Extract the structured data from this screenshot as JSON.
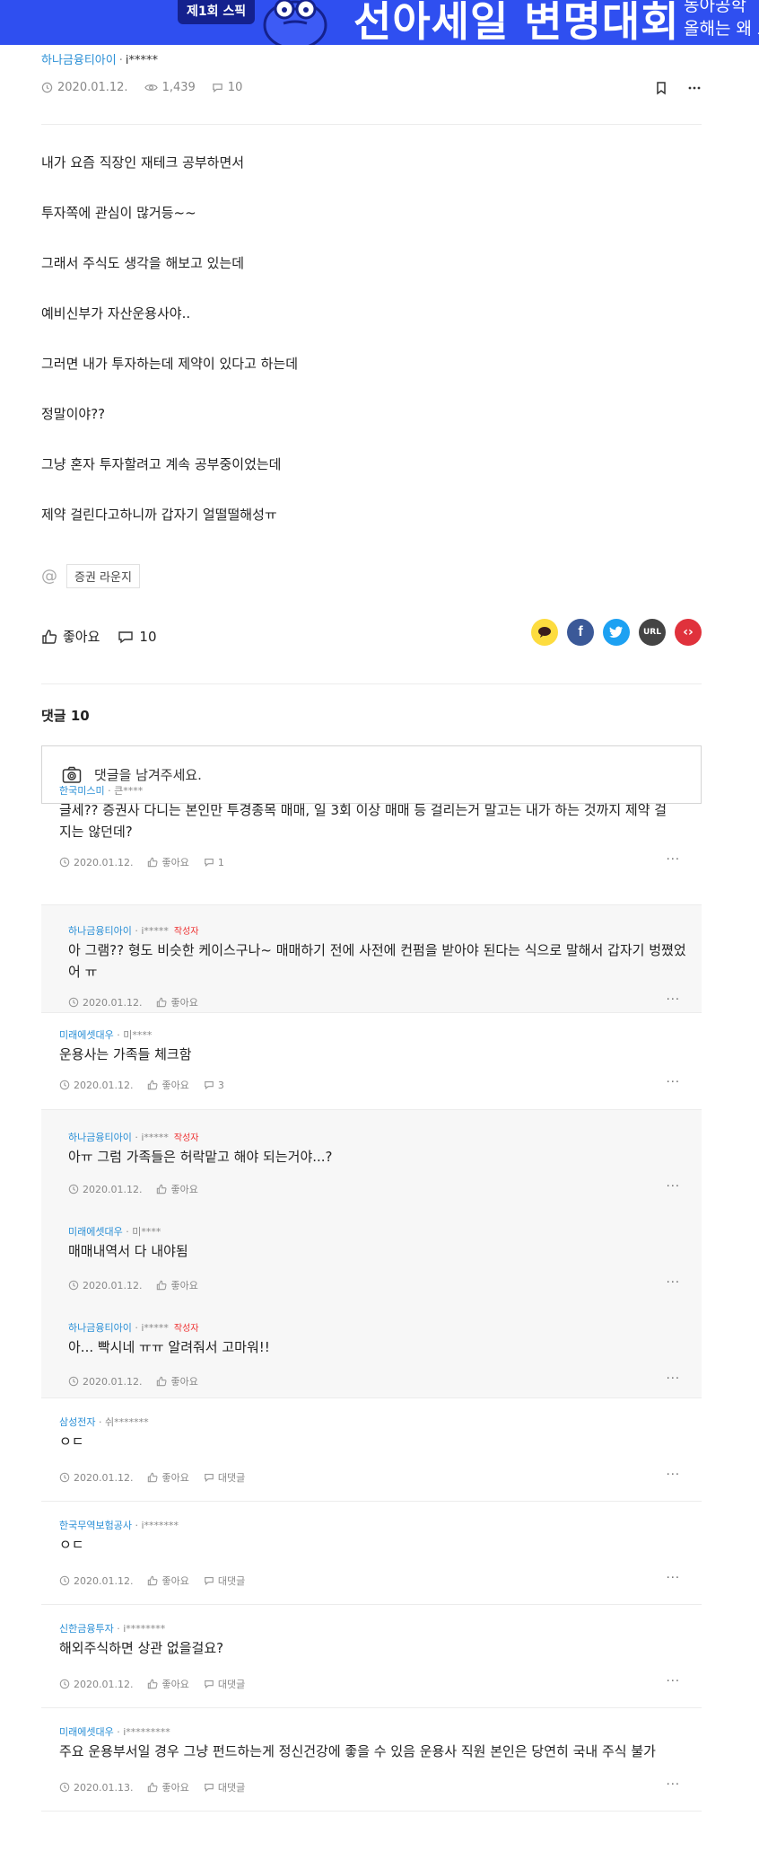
{
  "banner": {
    "badge": "제1회 스픽",
    "title": "선아세일 변명대회",
    "side_line1": "동아공학",
    "side_line2": "올해는 왜 도"
  },
  "post": {
    "company": "하나금융티아이",
    "user": "i*****",
    "date": "2020.01.12.",
    "views": "1,439",
    "comments": "10",
    "lines": [
      "내가 요즘 직장인 재테크 공부하면서",
      "투자쪽에 관심이 많거등~~",
      "그래서 주식도 생각을 해보고 있는데",
      "예비신부가 자산운용사야..",
      "그러면 내가 투자하는데 제약이 있다고 하는데",
      "정말이야??",
      "그냥 혼자 투자할려고 계속 공부중이었는데",
      "제약 걸린다고하니까 갑자기 얼떨떨해성ㅠ"
    ],
    "tag": "증권 라운지",
    "like_label": "좋아요",
    "comment_count": "10"
  },
  "share": {
    "url_label": "URL",
    "code_label": "‹›",
    "colors": {
      "kakao": "#fddc3f",
      "facebook": "#3b5998",
      "twitter": "#1da1f2",
      "url": "#444444",
      "code": "#e0323c"
    }
  },
  "comments_section": {
    "title": "댓글 10",
    "placeholder": "댓글을 남겨주세요."
  },
  "comments": [
    {
      "company": "한국미스미",
      "user": "큰****",
      "mine": "",
      "text": "글세?? 증권사 다니는 본인만 투경종목 매매, 일 3회 이상 매매 등 걸리는거 말고는 내가 하는 것까지 제약 걸지는 않던데?",
      "date": "2020.01.12.",
      "like": "좋아요",
      "extra": "1",
      "reply": false
    },
    {
      "company": "하나금융티아이",
      "user": "i*****",
      "mine": "작성자",
      "text": "아 그램?? 형도 비슷한 케이스구나~ 매매하기 전에 사전에 컨펌을 받아야 된다는 식으로 말해서 갑자기 벙쪘었어 ㅠ",
      "date": "2020.01.12.",
      "like": "좋아요",
      "extra": "",
      "reply": true
    },
    {
      "company": "미래에셋대우",
      "user": "미****",
      "mine": "",
      "text": "운용사는 가족들 체크함",
      "date": "2020.01.12.",
      "like": "좋아요",
      "extra": "3",
      "reply": false
    },
    {
      "company": "하나금융티아이",
      "user": "i*****",
      "mine": "작성자",
      "text": "아ㅠ 그럼 가족들은 허락맡고 해야 되는거야...?",
      "date": "2020.01.12.",
      "like": "좋아요",
      "extra": "",
      "reply": true
    },
    {
      "company": "미래에셋대우",
      "user": "미****",
      "mine": "",
      "text": "매매내역서 다 내야됨",
      "date": "2020.01.12.",
      "like": "좋아요",
      "extra": "",
      "reply": true
    },
    {
      "company": "하나금융티아이",
      "user": "i*****",
      "mine": "작성자",
      "text": "아... 빡시네 ㅠㅠ 알려줘서 고마워!!",
      "date": "2020.01.12.",
      "like": "좋아요",
      "extra": "",
      "reply": true
    },
    {
      "company": "삼성전자",
      "user": "쉬*******",
      "mine": "",
      "text": "ㅇㄷ",
      "date": "2020.01.12.",
      "like": "좋아요",
      "extra": "대댓글",
      "reply": false
    },
    {
      "company": "한국무역보험공사",
      "user": "i*******",
      "mine": "",
      "text": "ㅇㄷ",
      "date": "2020.01.12.",
      "like": "좋아요",
      "extra": "대댓글",
      "reply": false
    },
    {
      "company": "신한금융투자",
      "user": "i********",
      "mine": "",
      "text": "해외주식하면 상관 없을걸요?",
      "date": "2020.01.12.",
      "like": "좋아요",
      "extra": "대댓글",
      "reply": false
    },
    {
      "company": "미래에셋대우",
      "user": "i*********",
      "mine": "",
      "text": "주요 운용부서일 경우 그냥 펀드하는게 정신건강에 좋을 수 있음 운용사 직원 본인은 당연히 국내 주식 불가",
      "date": "2020.01.13.",
      "like": "좋아요",
      "extra": "대댓글",
      "reply": false
    }
  ]
}
